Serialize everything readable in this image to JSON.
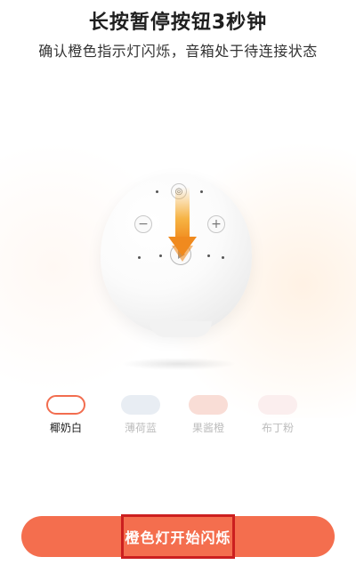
{
  "header": {
    "title": "长按暂停按钮3秒钟",
    "subtitle": "确认橙色指示灯闪烁，音箱处于待连接状态"
  },
  "device": {
    "image_name": "white-smart-speaker",
    "arrow_color": "#f5a623"
  },
  "color_options": [
    {
      "label": "椰奶白",
      "swatch": "#ffffff",
      "selected": true
    },
    {
      "label": "薄荷蓝",
      "swatch": "#e8edf3",
      "selected": false
    },
    {
      "label": "果酱橙",
      "swatch": "#f9ddd6",
      "selected": false
    },
    {
      "label": "布丁粉",
      "swatch": "#fbeeee",
      "selected": false
    }
  ],
  "primary_action": {
    "label": "橙色灯开始闪烁",
    "color": "#f46e4e",
    "highlight_color": "#cc1f1f"
  }
}
